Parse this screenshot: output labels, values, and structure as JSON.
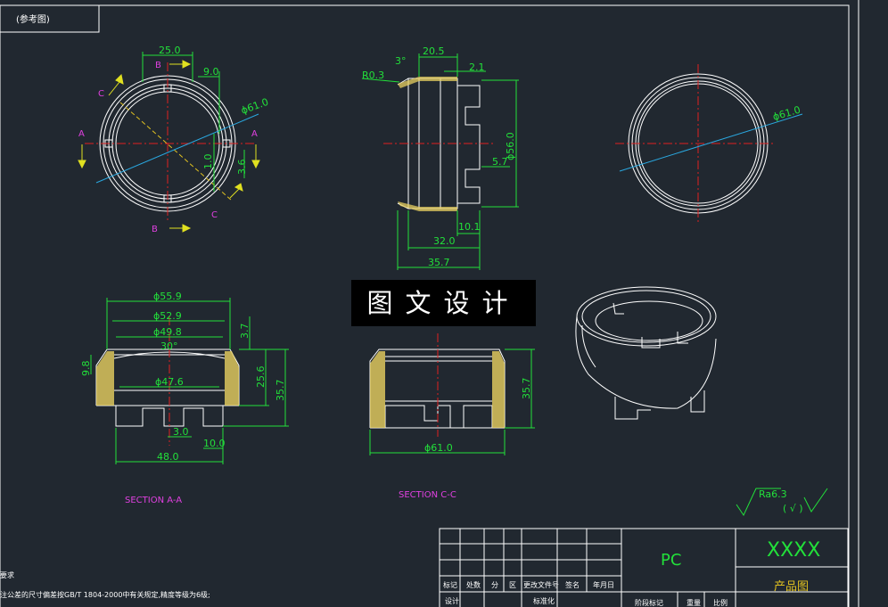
{
  "title_box": "(参考图)",
  "overlay": "图文设计",
  "top_left_view": {
    "dims": [
      "25.0",
      "9.0",
      "ϕ61.0",
      "1.0",
      "3.6"
    ],
    "section_labels": [
      "A",
      "A",
      "B",
      "B",
      "C",
      "C"
    ]
  },
  "top_mid_view": {
    "dims": [
      "20.5",
      "3°",
      "R0.3",
      "2.1",
      "ϕ56.0",
      "5.7",
      "10.1",
      "32.0",
      "35.7"
    ]
  },
  "top_right_view": {
    "dims": [
      "ϕ61.0"
    ]
  },
  "section_aa": {
    "dims": [
      "ϕ55.9",
      "ϕ52.9",
      "ϕ49.8",
      "3.7",
      "30°",
      "9.8",
      "ϕ47.6",
      "25.6",
      "35.7",
      "3.0",
      "10.0",
      "48.0"
    ],
    "caption": "SECTION A-A"
  },
  "section_cc": {
    "dims": [
      "35.7",
      "ϕ61.0"
    ],
    "caption": "SECTION C-C"
  },
  "roughness": {
    "value": "Ra6.3",
    "paren": "( √ )"
  },
  "notes": [
    "要求",
    "注公差的尺寸偏差按GB/T 1804-2000中有关规定,精度等级为6级;"
  ],
  "title_block": {
    "material": "PC",
    "part_code": "XXXX",
    "part_name": "产品图",
    "headers": [
      "标记",
      "处数",
      "分",
      "区",
      "更改文件号",
      "签名",
      "年月日"
    ],
    "row2": [
      "设计",
      "标准化"
    ],
    "stage": [
      "阶段标记",
      "重量",
      "比例"
    ]
  },
  "colors": {
    "background": "#212830",
    "outline": "#ffffff",
    "dimension": "#22e03a",
    "center_line": "#e02020",
    "section_label": "#e040e0",
    "hatch": "#e8d060",
    "leader": "#2aa8e0"
  }
}
